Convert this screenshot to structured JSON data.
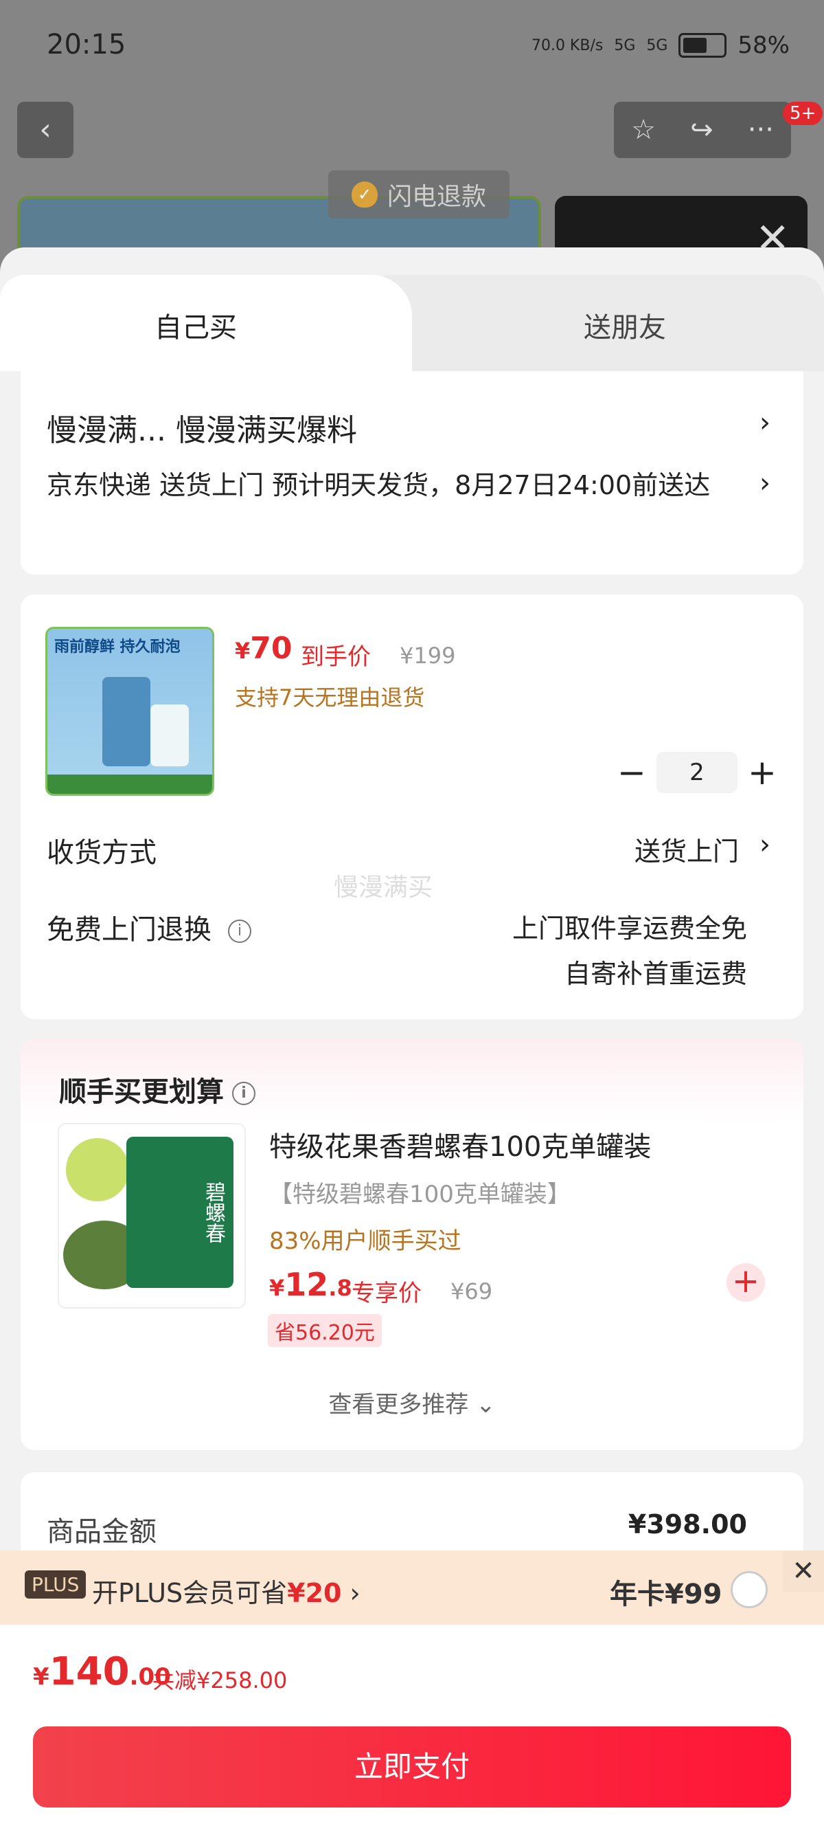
{
  "status_bar": {
    "time": "20:15",
    "net_speed": "70.0 KB/s",
    "signal1": "5G",
    "signal2": "5G",
    "battery": "58%"
  },
  "header": {
    "more_badge": "5+"
  },
  "background": {
    "refund_chip": "闪电退款"
  },
  "tabs": [
    {
      "label": "自己买"
    },
    {
      "label": "送朋友"
    }
  ],
  "address": {
    "name": "慢漫满...  慢漫满买爆料",
    "delivery": "京东快递 送货上门 预计明天发货，8月27日24:00前送达"
  },
  "product": {
    "image_title": "雨前醇鲜 持久耐泡",
    "price_yen": "¥",
    "price": "70",
    "price_tag": "到手价",
    "orig_price": "¥199",
    "return_policy": "支持7天无理由退货",
    "quantity": "2"
  },
  "rows": {
    "delivery_label": "收货方式",
    "delivery_value": "送货上门",
    "exchange_label": "免费上门退换",
    "exchange_value1": "上门取件享运费全免",
    "exchange_value2": "自寄补首重运费"
  },
  "watermark": "慢漫满买",
  "upsell": {
    "title": "顺手买更划算",
    "name": "特级花果香碧螺春100克单罐装",
    "spec": "【特级碧螺春100克单罐装】",
    "stat": "83%用户顺手买过",
    "price_yen": "¥",
    "price_int": "12",
    "price_dec": ".8",
    "price_tag": "专享价",
    "orig_price": "¥69",
    "save": "省56.20元",
    "can_text": "碧螺春",
    "more": "查看更多推荐"
  },
  "amount": {
    "label": "商品金额",
    "value": "¥398.00"
  },
  "plus": {
    "tag": "PLUS",
    "text": "开PLUS会员可省",
    "save": "¥20",
    "year_card": "年卡¥99"
  },
  "total": {
    "yen": "¥",
    "int": "140",
    "dec": ".00",
    "reduced": "共减¥258.00"
  },
  "pay_button": "立即支付",
  "colors": {
    "accent": "#e4292d",
    "gold": "#b8731f"
  }
}
